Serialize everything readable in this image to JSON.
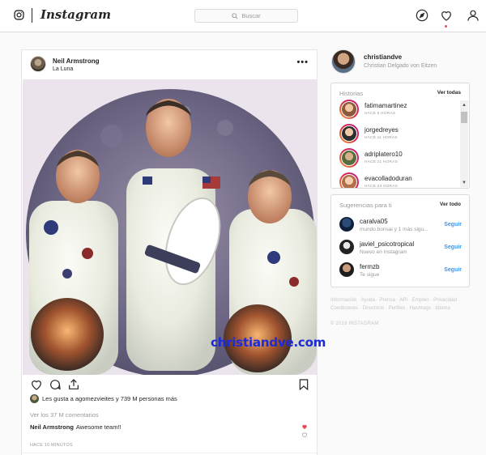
{
  "nav": {
    "brand": "Instagram",
    "search_placeholder": "Buscar",
    "icons": [
      "instagram-camera-icon",
      "explore-compass-icon",
      "activity-heart-icon",
      "profile-person-icon"
    ],
    "notification_color": "#ed4956"
  },
  "post": {
    "author": "Neil Armstrong",
    "location": "La Luna",
    "more": "•••",
    "watermark": "christiandve.com",
    "likes": "Les gusta a agomezvieites y 739 M personas más",
    "comments": "Ver los 37 M comentarios",
    "caption_author": "Neil Armstrong",
    "caption_text": "Awesome team!!",
    "caption_like_color": "#ed4956",
    "timestamp": "HACE 10 MINUTOS"
  },
  "profile": {
    "username": "christiandve",
    "fullname": "Christian Delgado von Eitzen"
  },
  "stories": {
    "title": "Historias",
    "see_all": "Ver todas",
    "items": [
      {
        "name": "fatimamartinez",
        "time": "HACE 6 HORAS"
      },
      {
        "name": "jorgedreyes",
        "time": "HACE 11 HORAS"
      },
      {
        "name": "adriplatero10",
        "time": "HACE 21 HORAS"
      },
      {
        "name": "evacolladoduran",
        "time": "HACE 23 HORAS"
      }
    ]
  },
  "suggestions": {
    "title": "Sugerencias para ti",
    "see_all": "Ver todo",
    "items": [
      {
        "name": "caralva05",
        "sub": "mundo.bonsai y 1 más sigu...",
        "action": "Seguir"
      },
      {
        "name": "javiel_psicotropical",
        "sub": "Nuevo en Instagram",
        "action": "Seguir"
      },
      {
        "name": "fermzb",
        "sub": "Te sigue",
        "action": "Seguir"
      }
    ]
  },
  "footer": {
    "links": "Información · Ayuda · Prensa · API · Empleo · Privacidad · Condiciones · Directorio · Perfiles · Hashtags · Idioma",
    "copyright": "© 2019 INSTAGRAM"
  }
}
